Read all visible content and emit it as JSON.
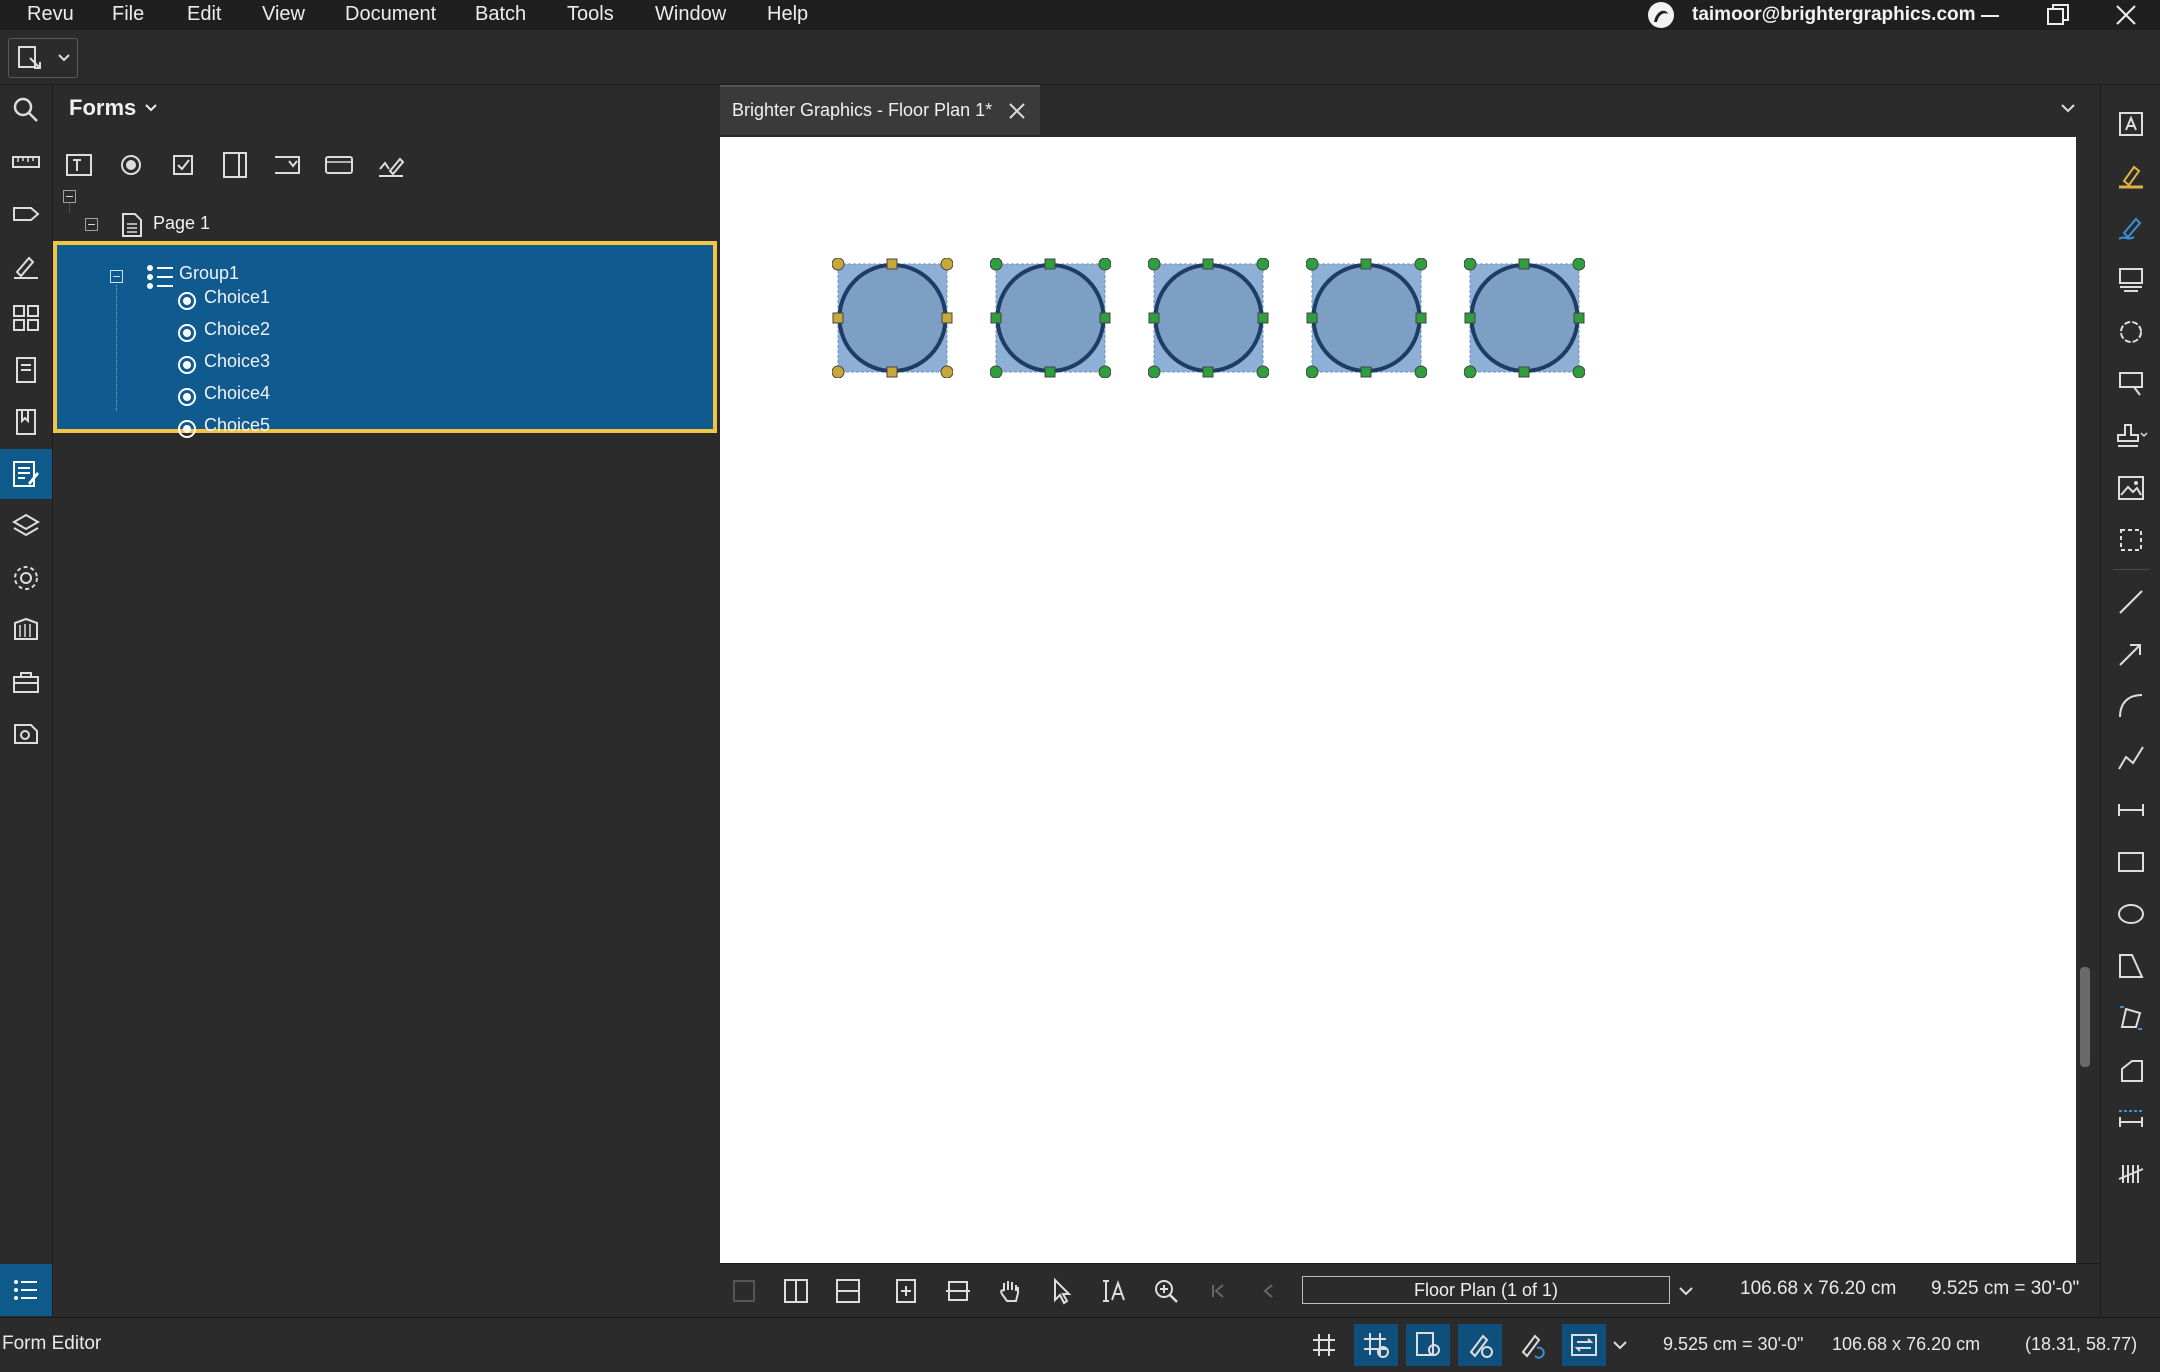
{
  "menu": {
    "items": [
      "Revu",
      "File",
      "Edit",
      "View",
      "Document",
      "Batch",
      "Tools",
      "Window",
      "Help"
    ],
    "account_email": "taimoor@brightergraphics.com"
  },
  "window_controls": [
    "minimize-icon",
    "restore-icon",
    "close-icon"
  ],
  "panel": {
    "title": "Forms",
    "tools": [
      "text-field-icon",
      "radio-button-icon",
      "checkbox-icon",
      "list-box-icon",
      "dropdown-icon",
      "button-icon",
      "signature-icon"
    ],
    "tree": {
      "page": "Page 1",
      "group": "Group1",
      "choices": [
        "Choice1",
        "Choice2",
        "Choice3",
        "Choice4",
        "Choice5"
      ]
    }
  },
  "left_rail": [
    "search-icon",
    "measure-icon",
    "tag-icon",
    "signature-pen-icon",
    "thumbnails-icon",
    "file-access-icon",
    "bookmarks-icon",
    "forms-icon",
    "layers-icon",
    "settings-icon",
    "studio-icon",
    "toolbox-icon",
    "markups-icon"
  ],
  "document": {
    "tab_title": "Brighter Graphics - Floor Plan 1*",
    "page_label": "Floor Plan (1 of 1)",
    "page_size": "106.68 x 76.20 cm",
    "scale": "9.525 cm = 30'-0\""
  },
  "status": {
    "mode": "Form Editor",
    "scale": "9.525 cm = 30'-0\"",
    "size": "106.68 x 76.20 cm",
    "cursor": "(18.31, 58.77)"
  },
  "right_rail": [
    "text-box-icon",
    "highlight-icon",
    "pen-icon",
    "typewriter-icon",
    "cloud-icon",
    "callout-icon",
    "stamp-icon",
    "image-icon",
    "snapshot-icon",
    "line-icon",
    "arrow-icon",
    "arc-icon",
    "polyline-icon",
    "dimension-icon",
    "rectangle-icon",
    "ellipse-icon",
    "polygon-icon",
    "measure-area-icon",
    "measure-perimeter-icon",
    "measure-length-icon",
    "count-icon"
  ],
  "colors": {
    "accent": "#0f5b8f",
    "selection_border": "#f4c542",
    "field_fill": "#8fb0d6",
    "handle_green": "#2e9e3e",
    "handle_yellow": "#c7a93a"
  }
}
